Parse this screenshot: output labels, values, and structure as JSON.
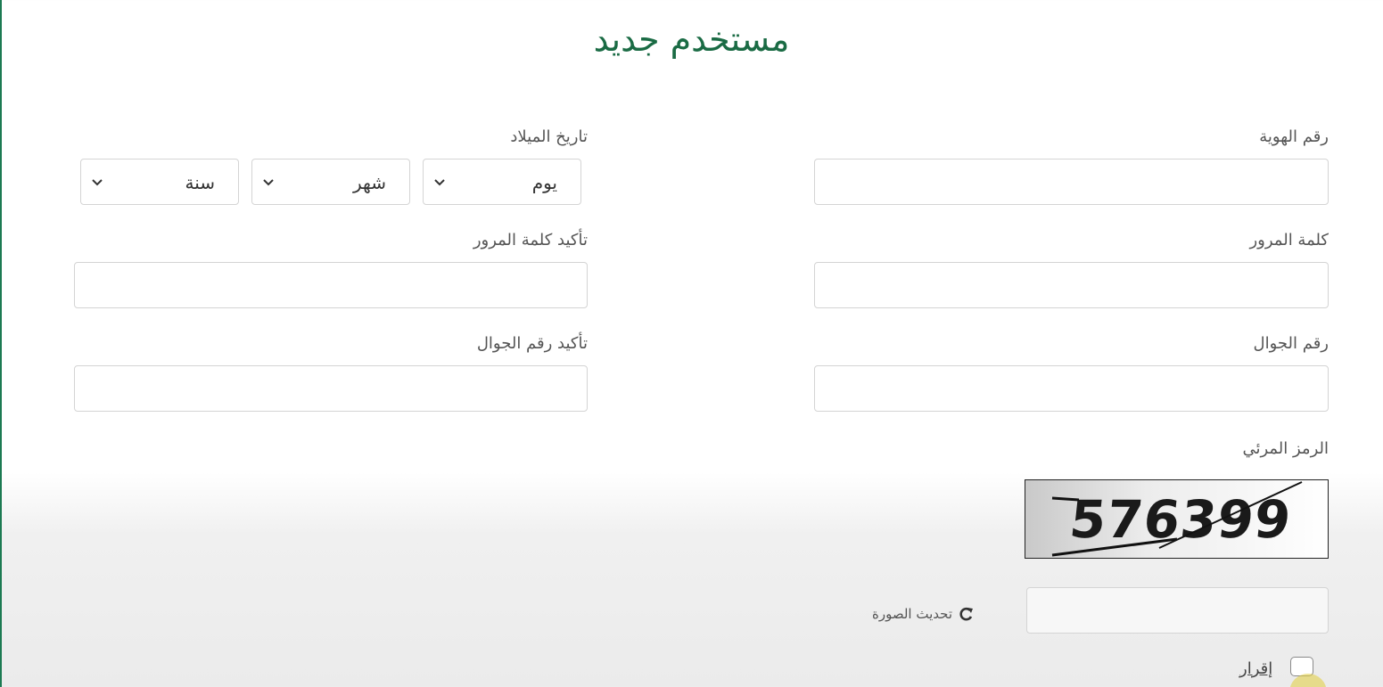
{
  "page": {
    "title": "مستخدم جديد"
  },
  "form": {
    "id_number": {
      "label": "رقم الهوية",
      "value": ""
    },
    "birth_date": {
      "label": "تاريخ الميلاد",
      "day": "يوم",
      "month": "شهر",
      "year": "سنة"
    },
    "password": {
      "label": "كلمة المرور",
      "value": ""
    },
    "confirm_password": {
      "label": "تأكيد كلمة المرور",
      "value": ""
    },
    "mobile": {
      "label": "رقم الجوال",
      "value": ""
    },
    "confirm_mobile": {
      "label": "تأكيد رقم الجوال",
      "value": ""
    },
    "captcha": {
      "label": "الرمز المرئي",
      "image_text": "576399",
      "value": "",
      "refresh_label": "تحديث الصورة",
      "refresh_icon": "refresh-icon"
    },
    "declaration": {
      "label": "إقرار",
      "checked": false
    }
  },
  "colors": {
    "accent": "#1a6b44",
    "border": "#d4d4d4",
    "text": "#555555"
  }
}
